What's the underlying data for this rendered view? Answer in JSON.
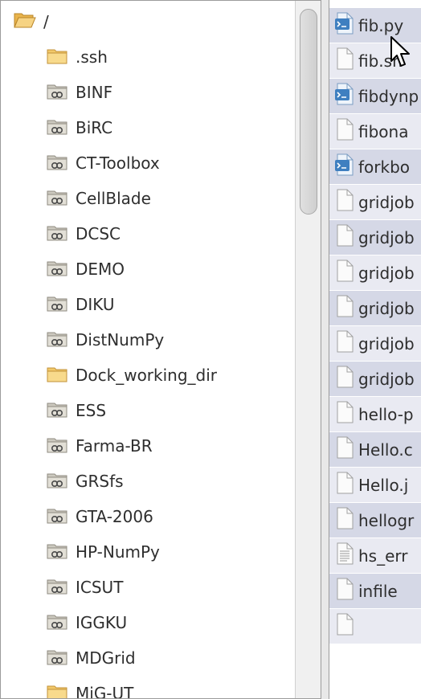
{
  "tree": {
    "root_label": "/",
    "items": [
      {
        "label": ".ssh",
        "icon": "folder-icon"
      },
      {
        "label": "BINF",
        "icon": "shared-folder-icon"
      },
      {
        "label": "BiRC",
        "icon": "shared-folder-icon"
      },
      {
        "label": "CT-Toolbox",
        "icon": "shared-folder-icon"
      },
      {
        "label": "CellBlade",
        "icon": "shared-folder-icon"
      },
      {
        "label": "DCSC",
        "icon": "shared-folder-icon"
      },
      {
        "label": "DEMO",
        "icon": "shared-folder-icon"
      },
      {
        "label": "DIKU",
        "icon": "shared-folder-icon"
      },
      {
        "label": "DistNumPy",
        "icon": "shared-folder-icon"
      },
      {
        "label": "Dock_working_dir",
        "icon": "folder-icon"
      },
      {
        "label": "ESS",
        "icon": "shared-folder-icon"
      },
      {
        "label": "Farma-BR",
        "icon": "shared-folder-icon"
      },
      {
        "label": "GRSfs",
        "icon": "shared-folder-icon"
      },
      {
        "label": "GTA-2006",
        "icon": "shared-folder-icon"
      },
      {
        "label": "HP-NumPy",
        "icon": "shared-folder-icon"
      },
      {
        "label": "ICSUT",
        "icon": "shared-folder-icon"
      },
      {
        "label": "IGGKU",
        "icon": "shared-folder-icon"
      },
      {
        "label": "MDGrid",
        "icon": "shared-folder-icon"
      },
      {
        "label": "MiG-UT",
        "icon": "folder-icon"
      }
    ]
  },
  "files": {
    "items": [
      {
        "label": "fib.py",
        "icon": "script-file-icon"
      },
      {
        "label": "fib.sh",
        "icon": "file-icon"
      },
      {
        "label": "fibdynp",
        "icon": "script-file-icon"
      },
      {
        "label": "fibona",
        "icon": "file-icon"
      },
      {
        "label": "forkbo",
        "icon": "script-file-icon"
      },
      {
        "label": "gridjob",
        "icon": "file-icon"
      },
      {
        "label": "gridjob",
        "icon": "file-icon"
      },
      {
        "label": "gridjob",
        "icon": "file-icon"
      },
      {
        "label": "gridjob",
        "icon": "file-icon"
      },
      {
        "label": "gridjob",
        "icon": "file-icon"
      },
      {
        "label": "gridjob",
        "icon": "file-icon"
      },
      {
        "label": "hello-p",
        "icon": "file-icon"
      },
      {
        "label": "Hello.c",
        "icon": "file-icon"
      },
      {
        "label": "Hello.j",
        "icon": "file-icon"
      },
      {
        "label": "hellogr",
        "icon": "file-icon"
      },
      {
        "label": "hs_err",
        "icon": "text-file-icon"
      },
      {
        "label": "infile",
        "icon": "file-icon"
      },
      {
        "label": "",
        "icon": "file-icon"
      }
    ]
  },
  "colors": {
    "row_odd": "#d5d8e6",
    "row_even": "#e9eaf2",
    "folder": "#f2c869",
    "script_accent": "#3f7fc0"
  }
}
